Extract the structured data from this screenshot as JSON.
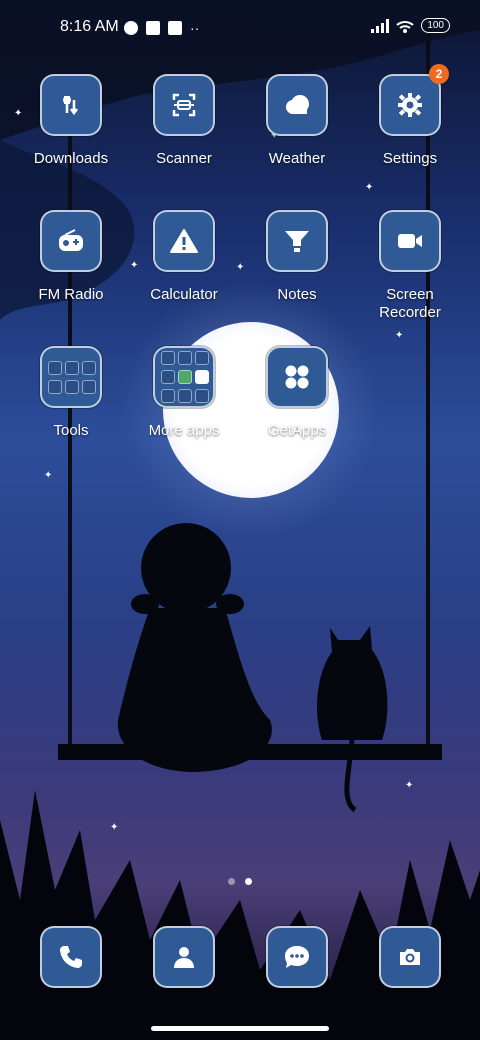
{
  "status_bar": {
    "time": "8:16 AM",
    "battery": "100"
  },
  "home": {
    "apps": [
      {
        "label": "Downloads",
        "icon": "download-icon"
      },
      {
        "label": "Scanner",
        "icon": "scanner-icon"
      },
      {
        "label": "Weather",
        "icon": "cloud-icon"
      },
      {
        "label": "Settings",
        "icon": "gear-icon",
        "badge": "2"
      },
      {
        "label": "FM Radio",
        "icon": "radio-icon"
      },
      {
        "label": "Calculator",
        "icon": "warning-icon"
      },
      {
        "label": "Notes",
        "icon": "notes-icon"
      },
      {
        "label": "Screen Recorder",
        "label_line1": "Screen",
        "label_line2": "Recorder",
        "icon": "video-camera-icon"
      },
      {
        "label": "Tools",
        "icon": "folder-icon"
      },
      {
        "label": "More apps",
        "icon": "folder-icon"
      },
      {
        "label": "GetApps",
        "icon": "getapps-icon"
      }
    ]
  },
  "page_indicator": {
    "pages": 2,
    "active": 2
  },
  "dock": [
    {
      "name": "phone",
      "icon": "phone-icon"
    },
    {
      "name": "contacts",
      "icon": "person-icon"
    },
    {
      "name": "messages",
      "icon": "chat-icon"
    },
    {
      "name": "camera",
      "icon": "camera-icon"
    }
  ],
  "colors": {
    "tile": "#2f5a95",
    "badge": "#f26a1b"
  }
}
